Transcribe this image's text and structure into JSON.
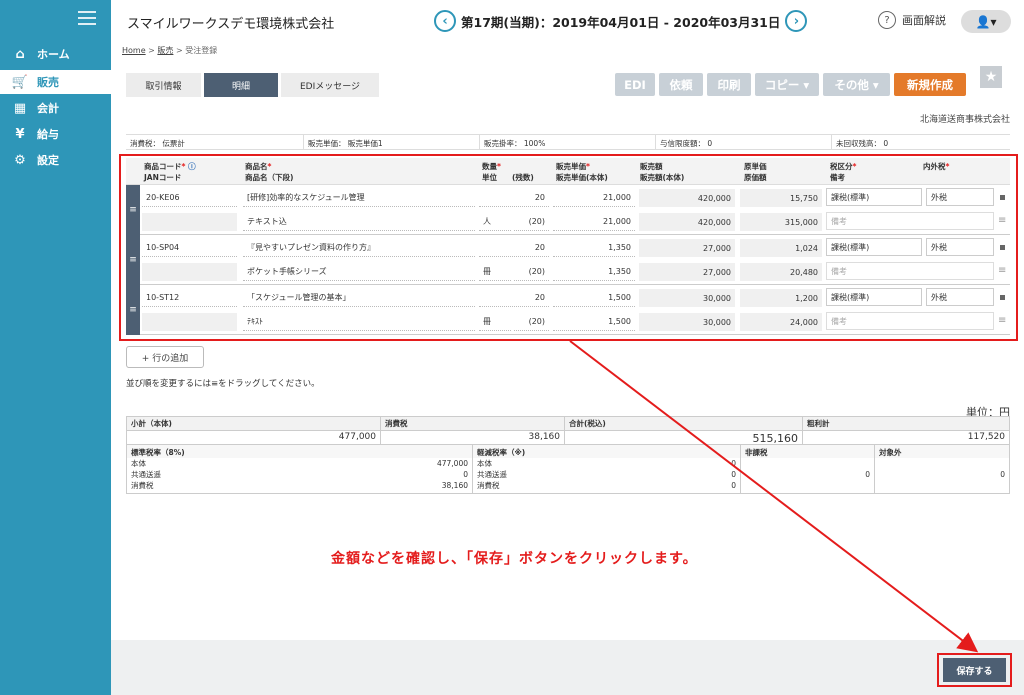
{
  "sidebar": {
    "items": [
      {
        "label": "ホーム",
        "icon": "home-icon",
        "glyph": "⌂"
      },
      {
        "label": "販売",
        "icon": "cart-icon",
        "glyph": "🛒"
      },
      {
        "label": "会計",
        "icon": "calculator-icon",
        "glyph": "▦"
      },
      {
        "label": "給与",
        "icon": "money-bag-icon",
        "glyph": "¥"
      },
      {
        "label": "設定",
        "icon": "gear-icon",
        "glyph": "⚙"
      }
    ],
    "active": 1
  },
  "header": {
    "company": "スマイルワークスデモ環境株式会社",
    "period": "第17期(当期)：2019年04月01日 - 2020年03月31日",
    "help": "画面解説",
    "user_glyph": "👤▾"
  },
  "breadcrumb": {
    "home": "Home",
    "sales": "販売",
    "current": "受注登録",
    "sep": ">"
  },
  "tabs": [
    "取引情報",
    "明細",
    "EDIメッセージ"
  ],
  "toolbar": {
    "buttons": [
      "EDI",
      "依頼",
      "印刷",
      "コピー ▾",
      "その他 ▾"
    ],
    "primary": "新規作成"
  },
  "client": "北海道送商事株式会社",
  "info": [
    {
      "l": "消費税：",
      "v": "伝票計"
    },
    {
      "l": "販売単価：",
      "v": "販売単価1"
    },
    {
      "l": "販売掛率：",
      "v": "100%"
    },
    {
      "l": "与信限度額：",
      "v": "0"
    },
    {
      "l": "未回収残高：",
      "v": "0"
    }
  ],
  "columns": {
    "code": "商品コード",
    "jan": "JANコード",
    "name": "商品名",
    "name2": "商品名（下段)",
    "qty": "数量",
    "unit": "単位",
    "rem": "(残数)",
    "price": "販売単価",
    "price2": "販売単価(本体)",
    "amt": "販売額",
    "amt2": "販売額(本体)",
    "cost": "原単価",
    "cost2": "原価額",
    "tax": "税区分",
    "note": "備考",
    "inc": "内外税",
    "req": "*",
    "info_icon": "ⓘ"
  },
  "rows": [
    {
      "code": "20-KE06",
      "name": "[研修]効率的なスケジュール管理",
      "name2": "テキスト込",
      "qty": "20",
      "unit": "人",
      "rem": "(20)",
      "price": "21,000",
      "price2": "21,000",
      "amt": "420,000",
      "amt2": "420,000",
      "cost": "15,750",
      "cost2": "315,000",
      "tax": "課税(標準)",
      "inc": "外税",
      "note": "備考"
    },
    {
      "code": "10-SP04",
      "name": "『見やすいプレゼン資料の作り方』",
      "name2": "ポケット手帳シリーズ",
      "qty": "20",
      "unit": "冊",
      "rem": "(20)",
      "price": "1,350",
      "price2": "1,350",
      "amt": "27,000",
      "amt2": "27,000",
      "cost": "1,024",
      "cost2": "20,480",
      "tax": "課税(標準)",
      "inc": "外税",
      "note": "備考"
    },
    {
      "code": "10-ST12",
      "name": "「スケジュール管理の基本」",
      "name2": "ﾃｷｽﾄ",
      "qty": "20",
      "unit": "冊",
      "rem": "(20)",
      "price": "1,500",
      "price2": "1,500",
      "amt": "30,000",
      "amt2": "30,000",
      "cost": "1,200",
      "cost2": "24,000",
      "tax": "課税(標準)",
      "inc": "外税",
      "note": "備考"
    }
  ],
  "add_row": "+ 行の追加",
  "drag_note": "並び順を変更するには≡をドラッグしてください。",
  "unit_label": "単位：円",
  "summary": {
    "subtotal_l": "小計（本体)",
    "subtotal": "477,000",
    "tax_l": "消費税",
    "tax": "38,160",
    "total_l": "合計(税込)",
    "total": "515,160",
    "gross_l": "粗利計",
    "gross": "117,520"
  },
  "taxes": {
    "std_l": "標準税率（8%)",
    "red_l": "軽減税率（※)",
    "non_l": "非課税",
    "out_l": "対象外",
    "body": "本体",
    "trans": "共通送遥",
    "ctax": "消費税",
    "std": [
      "477,000",
      "0",
      "38,160"
    ],
    "red": [
      "0",
      "0",
      "0"
    ],
    "non": "0",
    "out": "0"
  },
  "message": "金額などを確認し、「保存」ボタンをクリックします。",
  "save": "保存する"
}
